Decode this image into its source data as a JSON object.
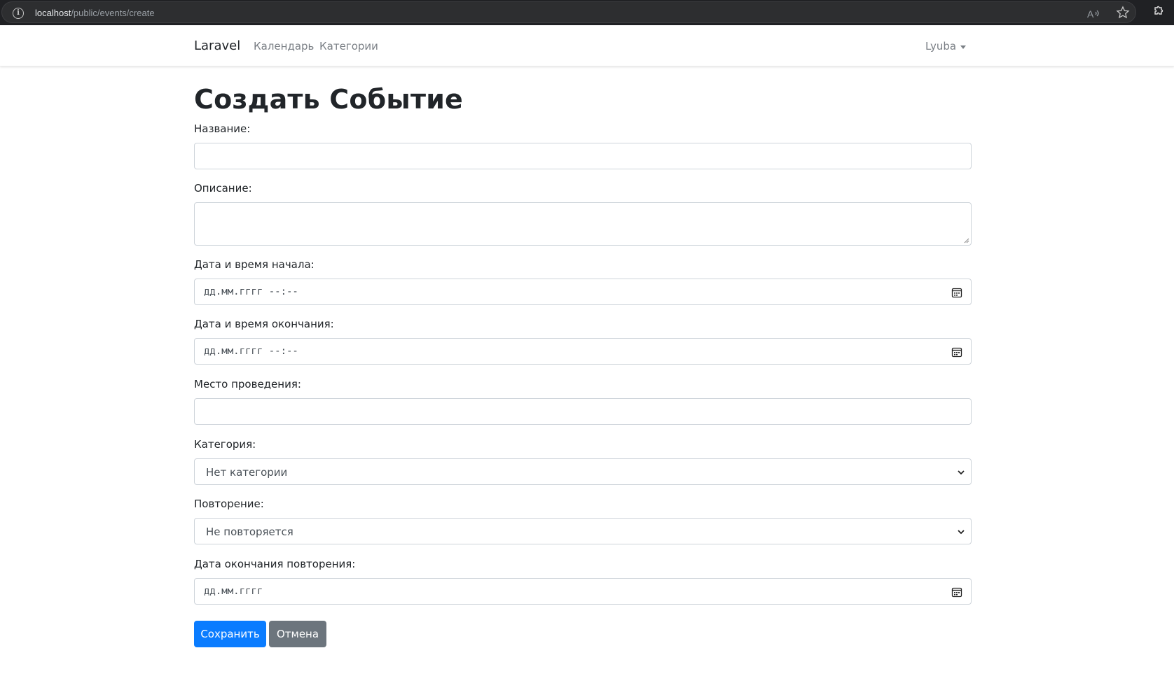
{
  "browser": {
    "url_host": "localhost",
    "url_path": "/public/events/create",
    "read_aloud_label": "Aʹ"
  },
  "navbar": {
    "brand": "Laravel",
    "links": [
      "Календарь",
      "Категории"
    ],
    "user": "Lyuba"
  },
  "form": {
    "title": "Создать Событие",
    "fields": {
      "name": {
        "label": "Название:",
        "value": ""
      },
      "description": {
        "label": "Описание:",
        "value": ""
      },
      "start": {
        "label": "Дата и время начала:",
        "placeholder": "дд.мм.гггг --:--"
      },
      "end": {
        "label": "Дата и время окончания:",
        "placeholder": "дд.мм.гггг --:--"
      },
      "location": {
        "label": "Место проведения:",
        "value": ""
      },
      "category": {
        "label": "Категория:",
        "selected": "Нет категории"
      },
      "repeat": {
        "label": "Повторение:",
        "selected": "Не повторяется"
      },
      "repeat_end": {
        "label": "Дата окончания повторения:",
        "placeholder": "дд.мм.гггг"
      }
    },
    "buttons": {
      "save": "Сохранить",
      "cancel": "Отмена"
    }
  },
  "colors": {
    "primary": "#0a7cff",
    "secondary": "#6c757d",
    "border": "#ced4da",
    "browser_bg": "#202124"
  }
}
